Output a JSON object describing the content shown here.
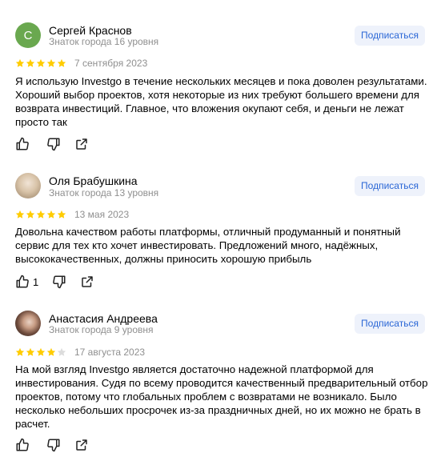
{
  "subscribe_label": "Подписаться",
  "colors": {
    "star": "#ffcc00",
    "star_empty": "#dcdcdc",
    "avatar_green": "#6aa84f",
    "link": "#2b67d6"
  },
  "reviews": [
    {
      "avatar_letter": "С",
      "name": "Сергей Краснов",
      "level": "Знаток города 16 уровня",
      "rating": 5,
      "date": "7 сентября 2023",
      "text": "Я использую Investgo в течение нескольких месяцев и пока доволен результатами. Хороший выбор проектов, хотя некоторые из них требуют большего времени для возврата инвестиций. Главное, что вложения окупают себя, и деньги не лежат просто так",
      "likes": ""
    },
    {
      "avatar_letter": "",
      "name": "Оля Брабушкина",
      "level": "Знаток города 13 уровня",
      "rating": 5,
      "date": "13 мая 2023",
      "text": "Довольна качеством работы платформы, отличный продуманный и понятный сервис для тех кто хочет инвестировать. Предложений много, надёжных, высококачественных, должны приносить хорошую прибыль",
      "likes": "1"
    },
    {
      "avatar_letter": "",
      "name": "Анастасия Андреева",
      "level": "Знаток города 9 уровня",
      "rating": 4,
      "date": "17 августа 2023",
      "text": "На мой взгляд Investgo является достаточно надежной платформой для инвестирования. Судя по всему проводится качественный предварительный отбор проектов, потому что глобальных проблем с возвратами не возникало. Было несколько небольших просрочек из-за праздничных дней, но их можно не брать в расчет.",
      "likes": ""
    }
  ]
}
